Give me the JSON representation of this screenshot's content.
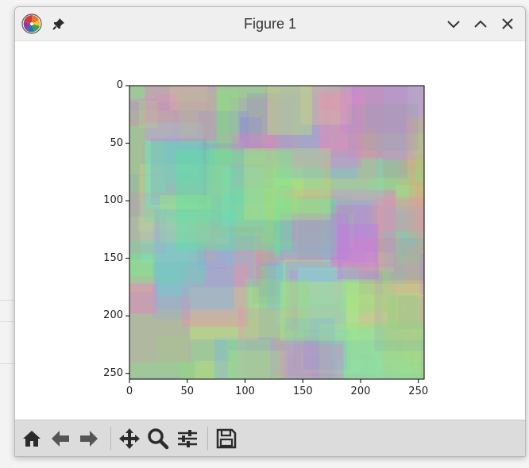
{
  "window": {
    "title": "Figure 1"
  },
  "plot": {
    "x_ticks": [
      "0",
      "50",
      "100",
      "150",
      "200",
      "250"
    ],
    "y_ticks": [
      "0",
      "50",
      "100",
      "150",
      "200",
      "250"
    ],
    "xlim": [
      0,
      255
    ],
    "ylim": [
      255,
      0
    ]
  },
  "toolbar": {
    "icons": [
      "home-icon",
      "back-icon",
      "forward-icon",
      "pan-icon",
      "zoom-icon",
      "configure-icon",
      "save-icon"
    ]
  },
  "colors": {
    "toolbar_bg": "#dcdcdc",
    "titlebar_bg": "#efefef",
    "icon_dark": "#2b2b2b"
  }
}
